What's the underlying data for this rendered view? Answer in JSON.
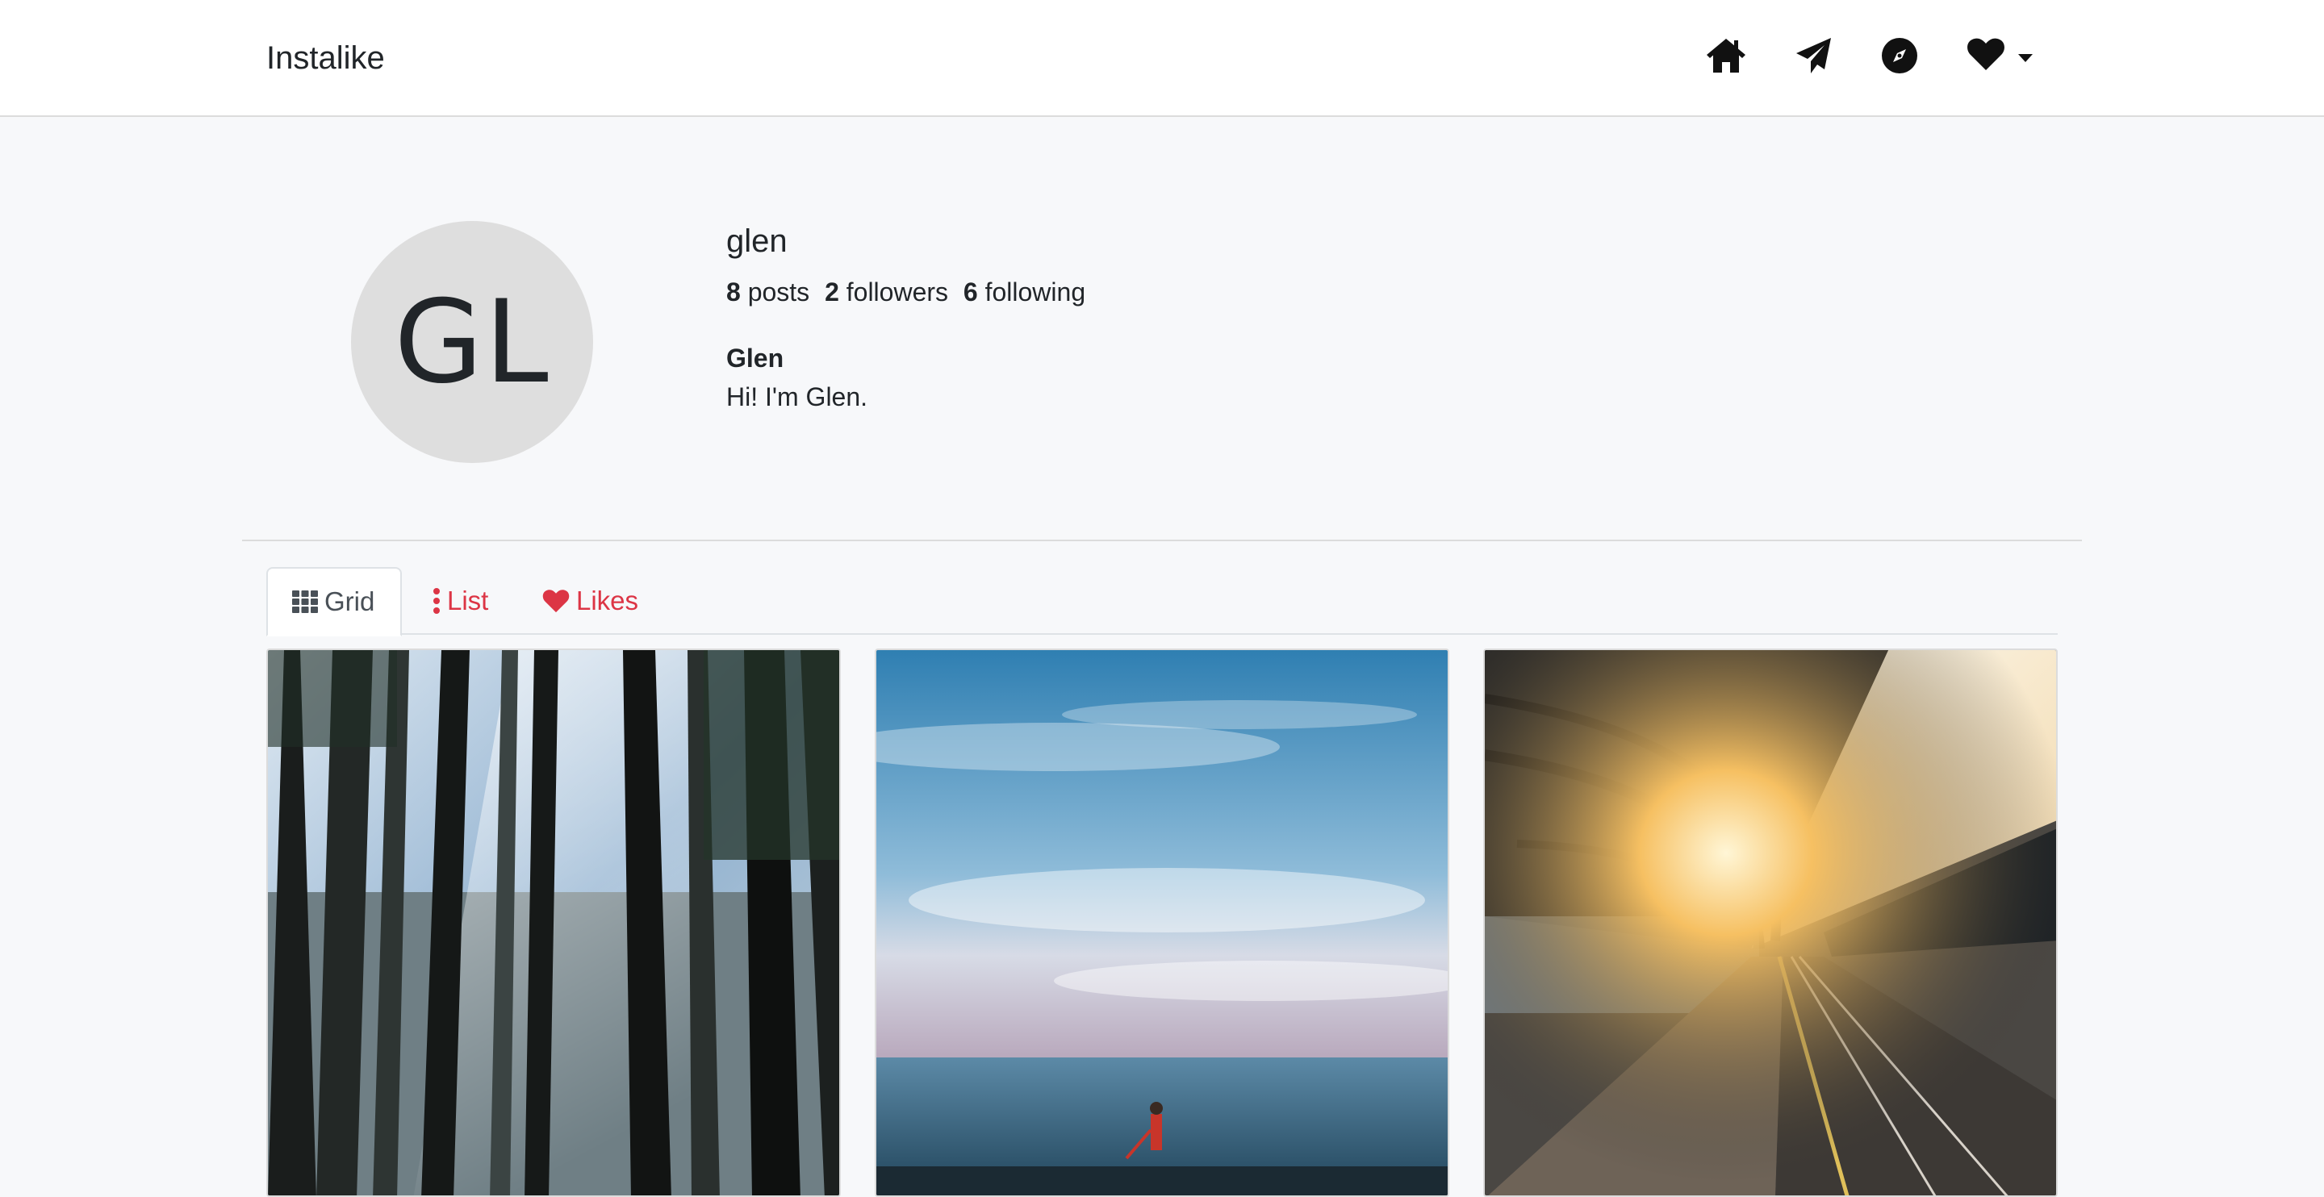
{
  "navbar": {
    "brand": "Instalike",
    "icons": [
      "home-icon",
      "paper-plane-icon",
      "compass-icon",
      "heart-icon",
      "caret-down-icon"
    ]
  },
  "profile": {
    "avatar_initials": "GL",
    "username": "glen",
    "posts_count": "8",
    "posts_label": "posts",
    "followers_count": "2",
    "followers_label": "followers",
    "following_count": "6",
    "following_label": "following",
    "full_name": "Glen",
    "bio": "Hi! I'm Glen."
  },
  "tabs": [
    {
      "label": "Grid",
      "icon": "grid-icon",
      "active": true
    },
    {
      "label": "List",
      "icon": "ellipsis-vertical-icon",
      "active": false
    },
    {
      "label": "Likes",
      "icon": "heart-icon",
      "active": false
    }
  ],
  "colors": {
    "accent": "#dc3545",
    "background": "#f7f8fa",
    "navbar": "#ffffff",
    "avatar_bg": "#dedede"
  },
  "posts": [
    {
      "subject": "forest"
    },
    {
      "subject": "sea-sky"
    },
    {
      "subject": "train-station"
    }
  ]
}
